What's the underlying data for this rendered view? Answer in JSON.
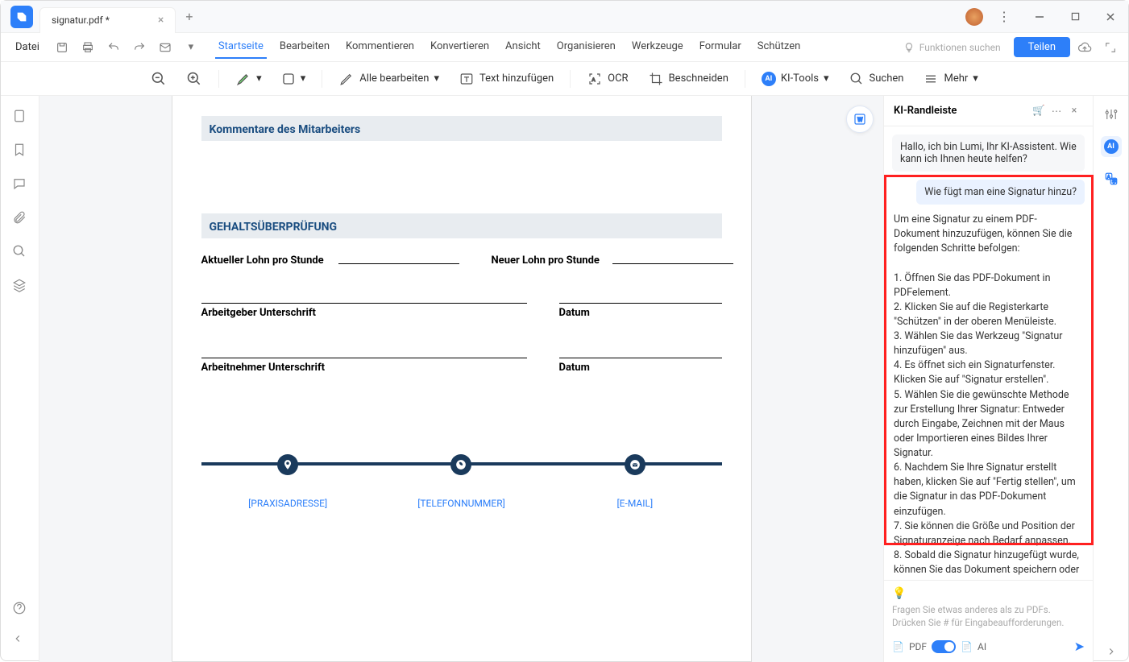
{
  "titlebar": {
    "tab_name": "signatur.pdf *"
  },
  "menubar": {
    "file": "Datei",
    "tabs": [
      "Startseite",
      "Bearbeiten",
      "Kommentieren",
      "Konvertieren",
      "Ansicht",
      "Organisieren",
      "Werkzeuge",
      "Formular",
      "Schützen"
    ],
    "active_index": 0,
    "search_placeholder": "Funktionen suchen",
    "share": "Teilen"
  },
  "toolbar": {
    "edit_all": "Alle bearbeiten",
    "add_text": "Text hinzufügen",
    "ocr": "OCR",
    "crop": "Beschneiden",
    "ai_tools": "KI-Tools",
    "search": "Suchen",
    "more": "Mehr"
  },
  "document": {
    "comments_title": "Kommentare des Mitarbeiters",
    "salary_title": "GEHALTSÜBERPRÜFUNG",
    "current_wage": "Aktueller Lohn pro Stunde",
    "new_wage": "Neuer Lohn pro Stunde",
    "employer_sig": "Arbeitgeber Unterschrift",
    "employee_sig": "Arbeitnehmer Unterschrift",
    "date": "Datum",
    "footer_addr": "[PRAXISADRESSE]",
    "footer_phone": "[TELEFONNUMMER]",
    "footer_email": "[E-MAIL]"
  },
  "ai": {
    "panel_title": "KI-Randleiste",
    "greeting": "Hallo, ich bin Lumi, Ihr KI-Assistent. Wie kann ich Ihnen heute helfen?",
    "user_q": "Wie fügt man eine Signatur hinzu?",
    "answer_intro": "Um eine Signatur zu einem PDF-Dokument hinzuzufügen, können Sie die folgenden Schritte befolgen:",
    "answer_steps": [
      "1. Öffnen Sie das PDF-Dokument in PDFelement.",
      "2. Klicken Sie auf die Registerkarte \"Schützen\" in der oberen Menüleiste.",
      "3. Wählen Sie das Werkzeug \"Signatur hinzufügen\" aus.",
      "4. Es öffnet sich ein Signaturfenster. Klicken Sie auf \"Signatur erstellen\".",
      "5. Wählen Sie die gewünschte Methode zur Erstellung Ihrer Signatur: Entweder durch Eingabe, Zeichnen mit der Maus oder Importieren eines Bildes Ihrer Signatur.",
      "6. Nachdem Sie Ihre Signatur erstellt haben, klicken Sie auf \"Fertig stellen\", um die Signatur in das PDF-Dokument einzufügen.",
      "7. Sie können die Größe und Position der Signaturanzeige nach Bedarf anpassen.",
      "8. Sobald die Signatur hinzugefügt wurde, können Sie das Dokument speichern oder"
    ],
    "prompt_placeholder": "Fragen Sie etwas anderes als zu PDFs. Drücken Sie # für Eingabeaufforderungen.",
    "pdf_label": "PDF",
    "ai_label": "AI"
  }
}
